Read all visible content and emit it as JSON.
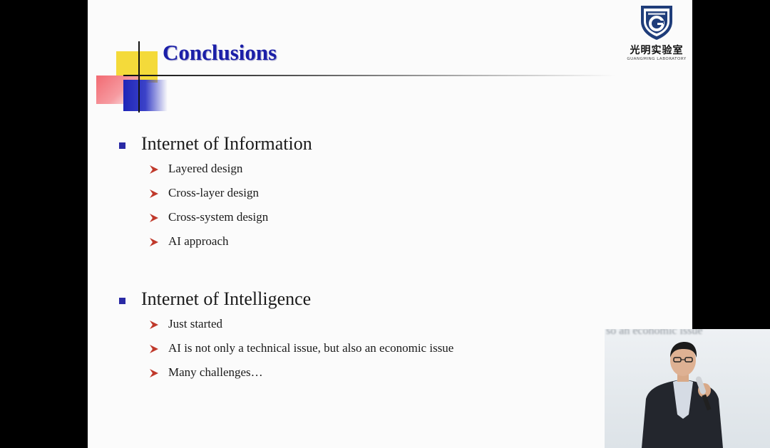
{
  "slide": {
    "title": "Conclusions",
    "logo": {
      "name_cn": "光明实验室",
      "name_en": "GUANGMING LABORATORY",
      "shield_text": "GUANGMING LABORATORY",
      "colors": {
        "navy": "#1f3d7a",
        "white": "#ffffff"
      }
    },
    "sections": [
      {
        "heading": "Internet of Information",
        "items": [
          "Layered design",
          "Cross-layer design",
          "Cross-system design",
          "AI approach"
        ]
      },
      {
        "heading": "Internet of Intelligence",
        "items": [
          "Just started",
          "AI is not only a technical issue, but also an economic issue",
          "Many challenges…"
        ]
      }
    ],
    "colors": {
      "title": "#1b1fa8",
      "bullet_square": "#2a2aa5",
      "arrow": "#c0392b",
      "accent_yellow": "#f4da3a",
      "accent_red": "#f26a72",
      "accent_blue": "#1e25b8"
    }
  },
  "video": {
    "blurred_caption": "so an economic issue"
  }
}
